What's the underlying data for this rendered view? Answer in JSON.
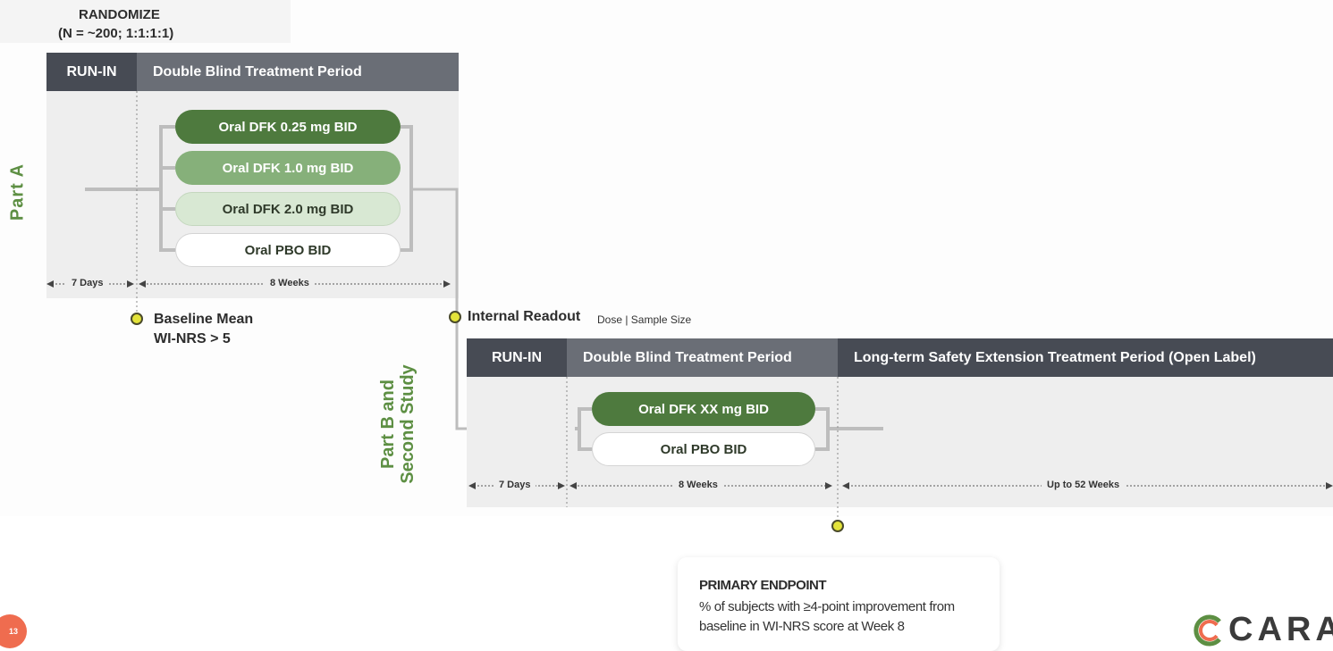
{
  "randomize": {
    "line1": "RANDOMIZE",
    "line2": "(N = ~200; 1:1:1:1)"
  },
  "part_a": {
    "label": "Part A",
    "run_in": "RUN-IN",
    "double_blind": "Double Blind Treatment Period",
    "arms": [
      "Oral DFK 0.25 mg BID",
      "Oral DFK 1.0 mg BID",
      "Oral DFK 2.0 mg BID",
      "Oral PBO BID"
    ],
    "run_in_duration": "7 Days",
    "treatment_duration": "8 Weeks",
    "baseline_line1": "Baseline Mean",
    "baseline_line2": "WI-NRS > 5"
  },
  "internal_readout": {
    "title": "Internal Readout",
    "subtitle": "Dose | Sample Size"
  },
  "part_b": {
    "label_line1": "Part B and",
    "label_line2": "Second Study",
    "run_in": "RUN-IN",
    "double_blind": "Double Blind Treatment Period",
    "extension": "Long-term Safety Extension Treatment Period (Open Label)",
    "arms": [
      "Oral DFK XX mg BID",
      "Oral PBO BID"
    ],
    "run_in_duration": "7 Days",
    "treatment_duration": "8 Weeks",
    "extension_duration": "Up to 52 Weeks"
  },
  "endpoint": {
    "title": "PRIMARY ENDPOINT",
    "line1": "% of subjects with ≥4-point improvement from",
    "line2": "baseline in WI-NRS score at Week 8"
  },
  "page_number": "13",
  "logo_text": "CARA",
  "colors": {
    "dark_green": "#4e7a3e",
    "mid_green": "#86b07a",
    "light_green": "#d8e8d3",
    "header": "#474b54",
    "header_alt": "#6a6e76",
    "accent": "#5d8f43",
    "dot": "#e3e33a",
    "page_badge": "#ef6c4f"
  }
}
